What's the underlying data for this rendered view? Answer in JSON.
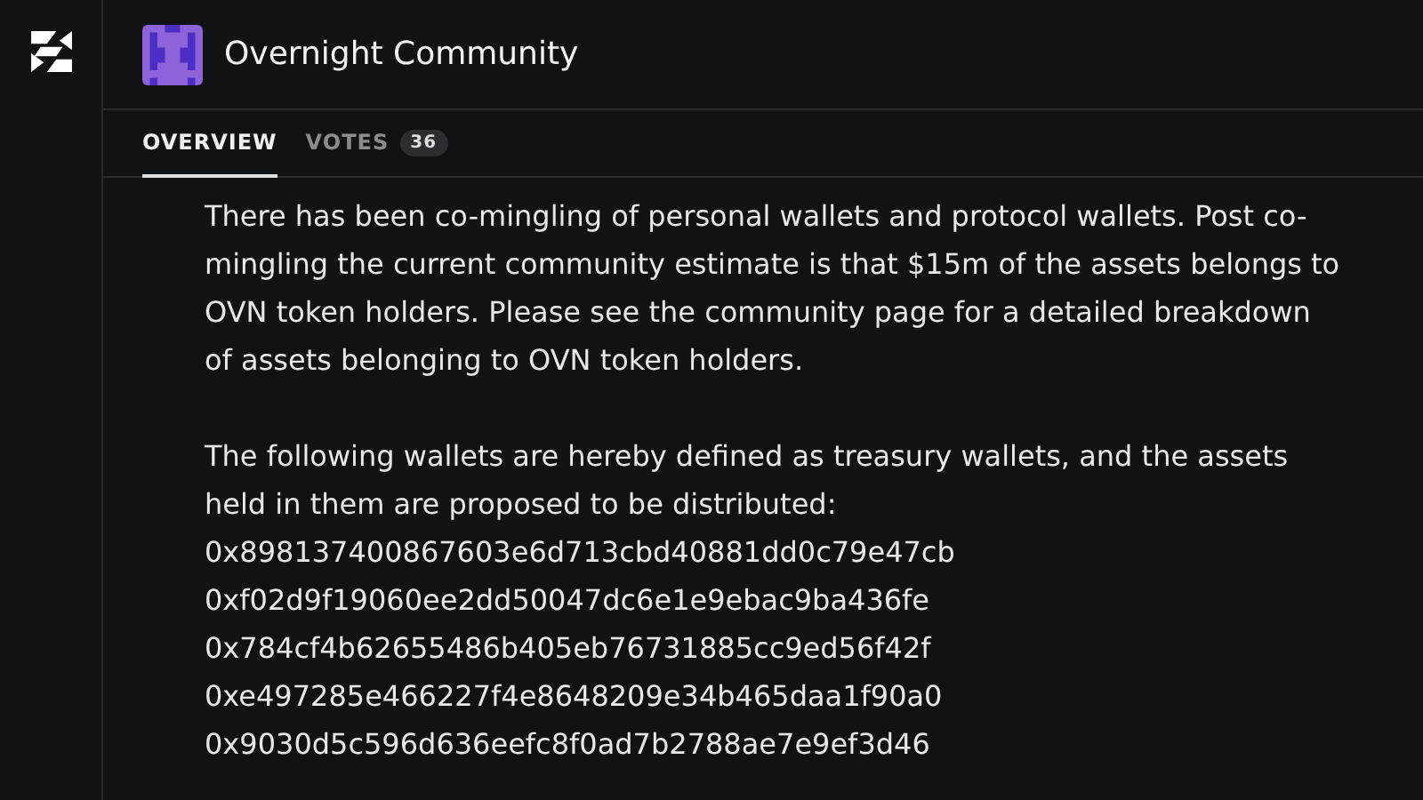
{
  "header": {
    "title": "Overnight Community"
  },
  "tabs": [
    {
      "label": "OVERVIEW",
      "selected": true
    },
    {
      "label": "VOTES",
      "selected": false,
      "count": "36"
    }
  ],
  "body": {
    "paragraphs": [
      "There has been co-mingling of personal wallets and protocol wallets. Post co-mingling the current community estimate is that $15m of the assets belongs to OVN token holders. Please see the community page for a detailed breakdown of assets belonging to OVN token holders.",
      "The following wallets are hereby defined as treasury wallets, and the assets held in them are proposed to be distributed:"
    ],
    "wallets": [
      "0x898137400867603e6d713cbd40881dd0c79e47cb",
      "0xf02d9f19060ee2dd50047dc6e1e9ebac9ba436fe",
      "0x784cf4b62655486b405eb76731885cc9ed56f42f",
      "0xe497285e466227f4e8648209e34b465daa1f90a0",
      "0x9030d5c596d636eefc8f0ad7b2788ae7e9ef3d46"
    ]
  }
}
